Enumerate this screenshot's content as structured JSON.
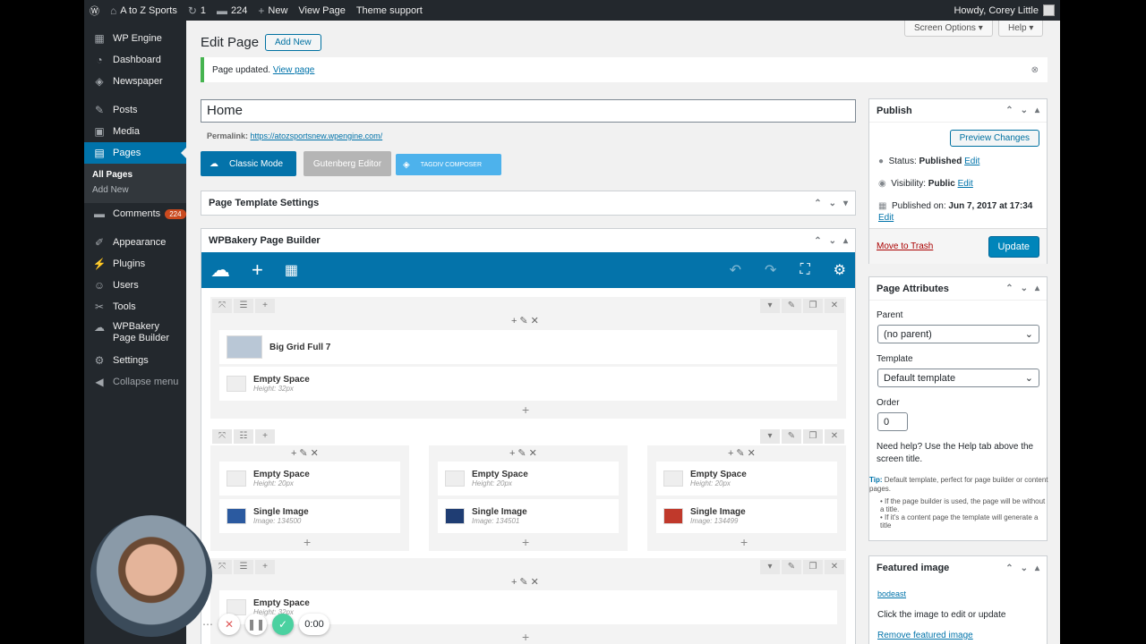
{
  "adminbar": {
    "site": "A to Z Sports",
    "updates": "1",
    "comments": "224",
    "new": "New",
    "view": "View Page",
    "theme": "Theme support",
    "howdy": "Howdy, Corey Little"
  },
  "sidebar": {
    "items": [
      {
        "label": "WP Engine",
        "icon": "wpengine-icon"
      },
      {
        "label": "Dashboard",
        "icon": "dashboard-icon"
      },
      {
        "label": "Newspaper",
        "icon": "newspaper-icon"
      },
      {
        "label": "Posts",
        "icon": "pin-icon"
      },
      {
        "label": "Media",
        "icon": "media-icon"
      },
      {
        "label": "Pages",
        "icon": "pages-icon"
      },
      {
        "label": "Comments",
        "icon": "comments-icon",
        "badge": "224"
      },
      {
        "label": "Appearance",
        "icon": "brush-icon"
      },
      {
        "label": "Plugins",
        "icon": "plug-icon"
      },
      {
        "label": "Users",
        "icon": "users-icon"
      },
      {
        "label": "Tools",
        "icon": "wrench-icon"
      },
      {
        "label": "WPBakery Page Builder",
        "icon": "cloud-icon"
      },
      {
        "label": "Settings",
        "icon": "settings-icon"
      },
      {
        "label": "Collapse menu",
        "icon": "collapse-icon"
      }
    ],
    "sub": {
      "all": "All Pages",
      "add": "Add New"
    }
  },
  "header": {
    "title": "Edit Page",
    "add_new": "Add New",
    "screen_options": "Screen Options",
    "help": "Help"
  },
  "notice": {
    "text": "Page updated.",
    "link": "View page"
  },
  "post_title": "Home",
  "permalink": {
    "label": "Permalink:",
    "url": "https://atozsportsnew.wpengine.com/"
  },
  "editors": {
    "classic": "Classic Mode",
    "gutenberg": "Gutenberg Editor",
    "tagdiv": "TAGDIV COMPOSER"
  },
  "boxes": {
    "template": "Page Template Settings",
    "wpb": "WPBakery Page Builder"
  },
  "wpb": {
    "row1": [
      {
        "title": "Big Grid Full 7",
        "sub": ""
      },
      {
        "title": "Empty Space",
        "sub": "Height: 32px"
      }
    ],
    "cols": [
      {
        "space": "Empty Space",
        "space_sub": "Height: 20px",
        "img": "Single Image",
        "img_sub": "Image: 134500"
      },
      {
        "space": "Empty Space",
        "space_sub": "Height: 20px",
        "img": "Single Image",
        "img_sub": "Image: 134501"
      },
      {
        "space": "Empty Space",
        "space_sub": "Height: 20px",
        "img": "Single Image",
        "img_sub": "Image: 134499"
      }
    ],
    "row3": {
      "title": "Empty Space",
      "sub": "Height: 32px"
    }
  },
  "publish": {
    "title": "Publish",
    "preview": "Preview Changes",
    "status_label": "Status:",
    "status": "Published",
    "visibility_label": "Visibility:",
    "visibility": "Public",
    "published_label": "Published on:",
    "published": "Jun 7, 2017 at 17:34",
    "edit": "Edit",
    "trash": "Move to Trash",
    "update": "Update"
  },
  "attributes": {
    "title": "Page Attributes",
    "parent_label": "Parent",
    "parent": "(no parent)",
    "template_label": "Template",
    "template": "Default template",
    "order_label": "Order",
    "order": "0",
    "help": "Need help? Use the Help tab above the screen title.",
    "tip_label": "Tip:",
    "tip": "Default template, perfect for page builder or content pages.",
    "bullet1": "If the page builder is used, the page will be without a title.",
    "bullet2": "If it's a content page the template will generate a title"
  },
  "featured": {
    "title": "Featured image",
    "alt": "bodeast",
    "hint": "Click the image to edit or update",
    "remove": "Remove featured image"
  },
  "recorder": {
    "time": "0:00"
  }
}
